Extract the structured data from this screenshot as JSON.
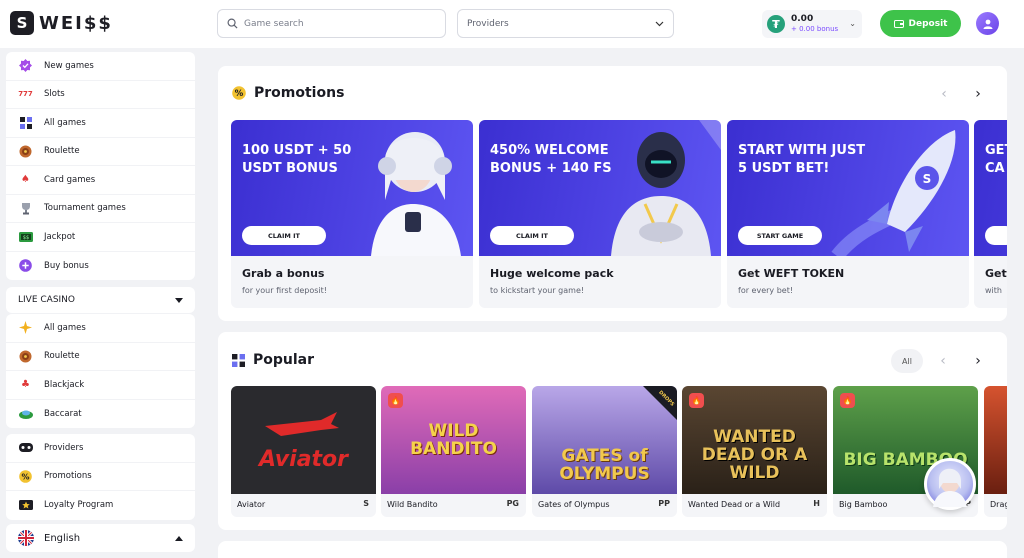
{
  "brand": {
    "logo_mark": "S",
    "name": "WEI$$"
  },
  "header": {
    "search_placeholder": "Game search",
    "providers_label": "Providers",
    "balance": "0.00",
    "bonus": "+ 0.00 bonus",
    "currency_icon": "tether-icon",
    "deposit_label": "Deposit"
  },
  "sidebar": {
    "main_items": [
      {
        "label": "New games",
        "icon": "new-games-icon"
      },
      {
        "label": "Slots",
        "icon": "slots-icon"
      },
      {
        "label": "All games",
        "icon": "all-games-icon"
      },
      {
        "label": "Roulette",
        "icon": "roulette-icon"
      },
      {
        "label": "Card games",
        "icon": "card-games-icon"
      },
      {
        "label": "Tournament games",
        "icon": "tournament-icon"
      },
      {
        "label": "Jackpot",
        "icon": "jackpot-icon"
      },
      {
        "label": "Buy bonus",
        "icon": "buy-bonus-icon"
      }
    ],
    "live_casino_label": "LIVE CASINO",
    "live_items": [
      {
        "label": "All games",
        "icon": "all-games-icon"
      },
      {
        "label": "Roulette",
        "icon": "roulette-icon"
      },
      {
        "label": "Blackjack",
        "icon": "blackjack-icon"
      },
      {
        "label": "Baccarat",
        "icon": "baccarat-icon"
      }
    ],
    "extra_items": [
      {
        "label": "Providers",
        "icon": "providers-icon"
      },
      {
        "label": "Promotions",
        "icon": "promotions-icon"
      },
      {
        "label": "Loyalty Program",
        "icon": "loyalty-icon"
      }
    ],
    "language": "English"
  },
  "promotions": {
    "title": "Promotions",
    "cards": [
      {
        "headline": "100 USDT + 50 USDT BONUS",
        "button": "CLAIM IT",
        "title": "Grab a bonus",
        "subtitle": "for your first deposit!"
      },
      {
        "headline": "450% WELCOME BONUS + 140 FS",
        "button": "CLAIM IT",
        "title": "Huge welcome pack",
        "subtitle": "to kickstart your game!"
      },
      {
        "headline": "START WITH JUST 5 USDT BET!",
        "button": "START GAME",
        "title": "Get WEFT TOKEN",
        "subtitle": "for every bet!"
      },
      {
        "headline": "GET CA",
        "button": "",
        "title": "Get",
        "subtitle": "with"
      }
    ]
  },
  "popular": {
    "title": "Popular",
    "all_label": "All",
    "games": [
      {
        "name": "Aviator",
        "art_title": "Aviator",
        "provider": "S",
        "hot": false,
        "bg": "#2a2a2e",
        "fg": "#e02a2a"
      },
      {
        "name": "Wild Bandito",
        "art_title": "WILD BANDITO",
        "provider": "PG",
        "hot": true,
        "bg": "#c94b9a",
        "fg": "#f5d34a"
      },
      {
        "name": "Gates of Olympus",
        "art_title": "GATES of OLYMPUS",
        "provider": "PP",
        "hot": false,
        "bg": "#7a6ab8",
        "fg": "#f2c94c"
      },
      {
        "name": "Wanted Dead or a Wild",
        "art_title": "WANTED DEAD OR A WILD",
        "provider": "H",
        "hot": true,
        "bg": "#3a2f22",
        "fg": "#e8c15a"
      },
      {
        "name": "Big Bamboo",
        "art_title": "BIG BAMBOO",
        "provider": "P",
        "hot": true,
        "bg": "#2f6b3a",
        "fg": "#b8e36b"
      },
      {
        "name": "Drag",
        "art_title": "",
        "provider": "",
        "hot": false,
        "bg": "#a8361f",
        "fg": "#ffd36b"
      }
    ]
  },
  "colors": {
    "accent": "#3ec34a",
    "banner": "#4236d8",
    "bonus": "#7b4bff"
  }
}
